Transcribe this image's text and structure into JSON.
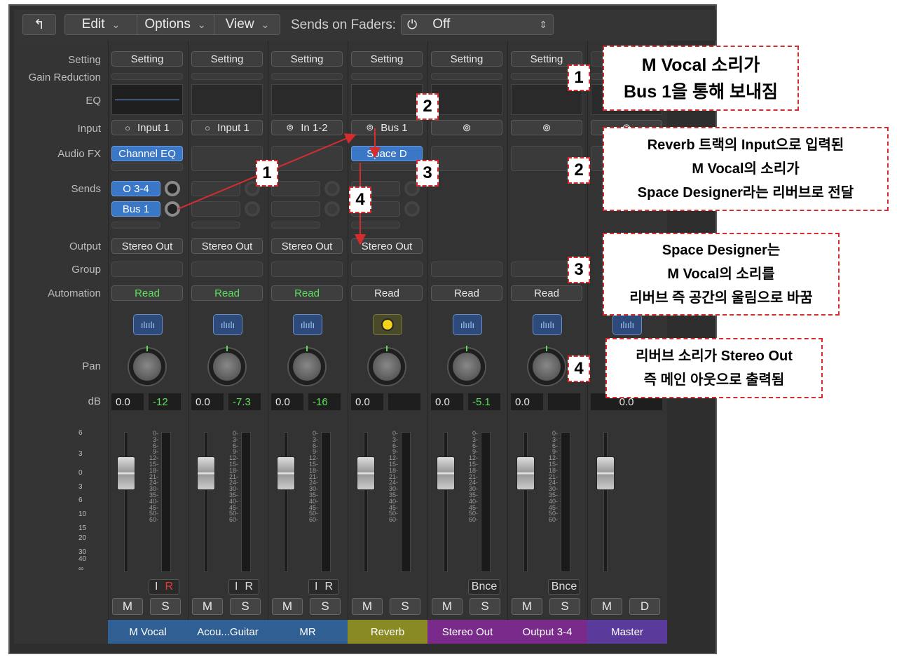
{
  "toolbar": {
    "edit": "Edit",
    "options": "Options",
    "view": "View",
    "sends_label": "Sends on Faders:",
    "sends_value": "Off"
  },
  "row_labels": {
    "setting": "Setting",
    "gain": "Gain Reduction",
    "eq": "EQ",
    "input": "Input",
    "audiofx": "Audio FX",
    "sends": "Sends",
    "output": "Output",
    "group": "Group",
    "automation": "Automation",
    "pan": "Pan",
    "db": "dB"
  },
  "strips": [
    {
      "name": "M Vocal",
      "setting": "Setting",
      "input": "Input 1",
      "fx": "Channel EQ",
      "send1": "O 3-4",
      "send2": "Bus 1",
      "output": "Stereo Out",
      "auto": "Read",
      "db1": "0.0",
      "db2": "-12",
      "i": "I",
      "r": "R",
      "m": "M",
      "s": "S",
      "color": "#2f5f93"
    },
    {
      "name": "Acou...Guitar",
      "setting": "Setting",
      "input": "Input 1",
      "output": "Stereo Out",
      "auto": "Read",
      "db1": "0.0",
      "db2": "-7.3",
      "i": "I",
      "r": "R",
      "m": "M",
      "s": "S",
      "color": "#2f5f93"
    },
    {
      "name": "MR",
      "setting": "Setting",
      "input": "In 1-2",
      "output": "Stereo Out",
      "auto": "Read",
      "db1": "0.0",
      "db2": "-16",
      "i": "I",
      "r": "R",
      "m": "M",
      "s": "S",
      "color": "#2f5f93"
    },
    {
      "name": "Reverb",
      "setting": "Setting",
      "input": "Bus 1",
      "fx": "Space D",
      "output": "Stereo Out",
      "auto": "Read",
      "db1": "0.0",
      "m": "M",
      "s": "S",
      "color": "#8a8a24"
    },
    {
      "name": "Stereo Out",
      "setting": "Setting",
      "auto": "Read",
      "db1": "0.0",
      "db2": "-5.1",
      "bnce": "Bnce",
      "m": "M",
      "s": "S",
      "color": "#7a2a8a"
    },
    {
      "name": "Output 3-4",
      "setting": "Setting",
      "auto": "Read",
      "db1": "0.0",
      "bnce": "Bnce",
      "m": "M",
      "s": "S",
      "color": "#7a2a8a"
    },
    {
      "name": "Master",
      "db1": "0.0",
      "m": "M",
      "d": "D",
      "color": "#5a3a9a"
    }
  ],
  "scale": [
    "6",
    "3",
    "0",
    "3",
    "6",
    "10",
    "15",
    "20",
    "30",
    "40",
    "∞"
  ],
  "meter_ticks": "0-\n3-\n6-\n9-\n12-\n15-\n18-\n21-\n24-\n30-\n35-\n40-\n45-\n50-\n60-",
  "badges": {
    "b1": "1",
    "b2": "2",
    "b3": "3",
    "b4": "4"
  },
  "annotations": {
    "a1_l1": "M Vocal 소리가",
    "a1_l2": "Bus 1을 통해 보내짐",
    "a2_l1": "Reverb 트랙의 Input으로 입력된",
    "a2_l2": "M Vocal의 소리가",
    "a2_l3": "Space Designer라는 리버브로 전달",
    "a3_l1": "Space Designer는",
    "a3_l2": "M Vocal의 소리를",
    "a3_l3": "리버브 즉 공간의 울림으로 바꿈",
    "a4_l1": "리버브 소리가 Stereo Out",
    "a4_l2": "즉 메인 아웃으로 출력됨"
  },
  "colors": {
    "arrow": "#d52d2d",
    "accent_blue": "#3a77c6",
    "read_green": "#5ce05c"
  }
}
